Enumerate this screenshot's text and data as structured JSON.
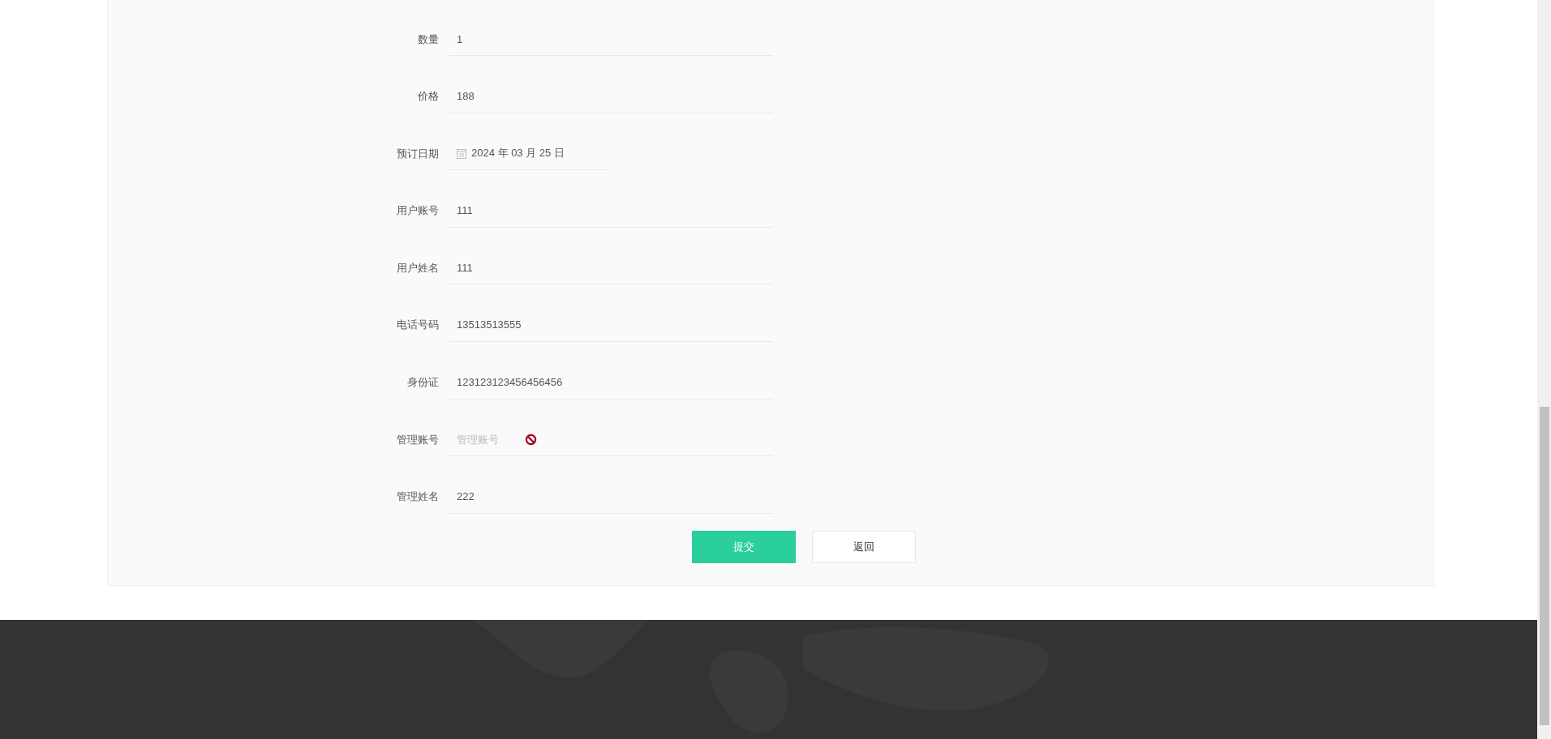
{
  "form": {
    "fields": [
      {
        "label": "数量",
        "kind": "text",
        "value": "1",
        "disabled": false
      },
      {
        "label": "价格",
        "kind": "text",
        "value": "188",
        "disabled": false
      },
      {
        "label": "预订日期",
        "kind": "date",
        "value": "2024 年 03 月 25 日",
        "disabled": false
      },
      {
        "label": "用户账号",
        "kind": "text",
        "value": "111",
        "disabled": false
      },
      {
        "label": "用户姓名",
        "kind": "text",
        "value": "111",
        "disabled": false
      },
      {
        "label": "电话号码",
        "kind": "text",
        "value": "13513513555",
        "disabled": false
      },
      {
        "label": "身份证",
        "kind": "text",
        "value": "123123123456456456",
        "disabled": false
      },
      {
        "label": "管理账号",
        "kind": "text",
        "placeholder": "管理账号",
        "disabled": true
      },
      {
        "label": "管理姓名",
        "kind": "text",
        "value": "222",
        "disabled": false
      }
    ],
    "buttons": [
      {
        "label": "提交",
        "kind": "primary"
      },
      {
        "label": "返回",
        "kind": "default"
      }
    ]
  }
}
